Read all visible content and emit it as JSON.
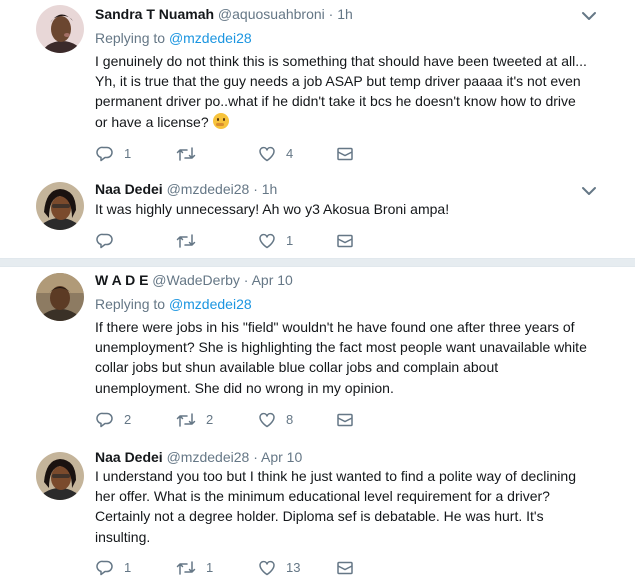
{
  "tweets": [
    {
      "name": "Sandra T Nuamah",
      "handle": "@aquosuahbroni",
      "dot": "·",
      "time": "1h",
      "replying_label": "Replying to",
      "replying_to": "@mzdedei28",
      "lines": [
        "I genuinely do not think this is something that should have been tweeted at all...",
        "Yh, it is true that the guy needs a job ASAP but temp driver paaaa it's not even",
        "permanent driver po..what if he didn't take it bcs he doesn't know how to drive",
        "or have a license?"
      ],
      "emoji": "thinking-face-emoji",
      "counts": {
        "reply": "1",
        "retweet": "",
        "like": "4"
      }
    },
    {
      "name": "Naa Dedei",
      "handle": "@mzdedei28",
      "dot": "·",
      "time": "1h",
      "lines": [
        "It was highly unnecessary! Ah wo y3 Akosua Broni ampa!"
      ],
      "counts": {
        "reply": "",
        "retweet": "",
        "like": "1"
      }
    },
    {
      "name": "W A D E",
      "handle": "@WadeDerby",
      "dot": "·",
      "time": "Apr 10",
      "replying_label": "Replying to",
      "replying_to": "@mzdedei28",
      "lines": [
        "If there were jobs in his \"field\" wouldn't he have found one after three years of",
        "unemployment? She is highlighting the fact most people want unavailable white",
        "collar jobs but shun available  blue collar jobs  and complain about",
        "unemployment. She did no wrong in my opinion."
      ],
      "counts": {
        "reply": "2",
        "retweet": "2",
        "like": "8"
      }
    },
    {
      "name": "Naa Dedei",
      "handle": "@mzdedei28",
      "dot": "·",
      "time": "Apr 10",
      "lines": [
        "I understand you too but I think he just wanted to find a polite way of declining",
        "her offer. What is the minimum educational level requirement for a driver?",
        "Certainly not a degree holder. Diploma sef is debatable. He was hurt. It's",
        "insulting."
      ],
      "counts": {
        "reply": "1",
        "retweet": "1",
        "like": "13"
      }
    }
  ],
  "icons": {
    "reply": "reply-icon",
    "retweet": "retweet-icon",
    "like": "heart-icon",
    "dm": "envelope-icon",
    "more": "chevron-down-icon"
  },
  "colors": {
    "link": "#1b95e0",
    "muted": "#657786",
    "text": "#14171a",
    "separator": "#e6ecf0"
  }
}
